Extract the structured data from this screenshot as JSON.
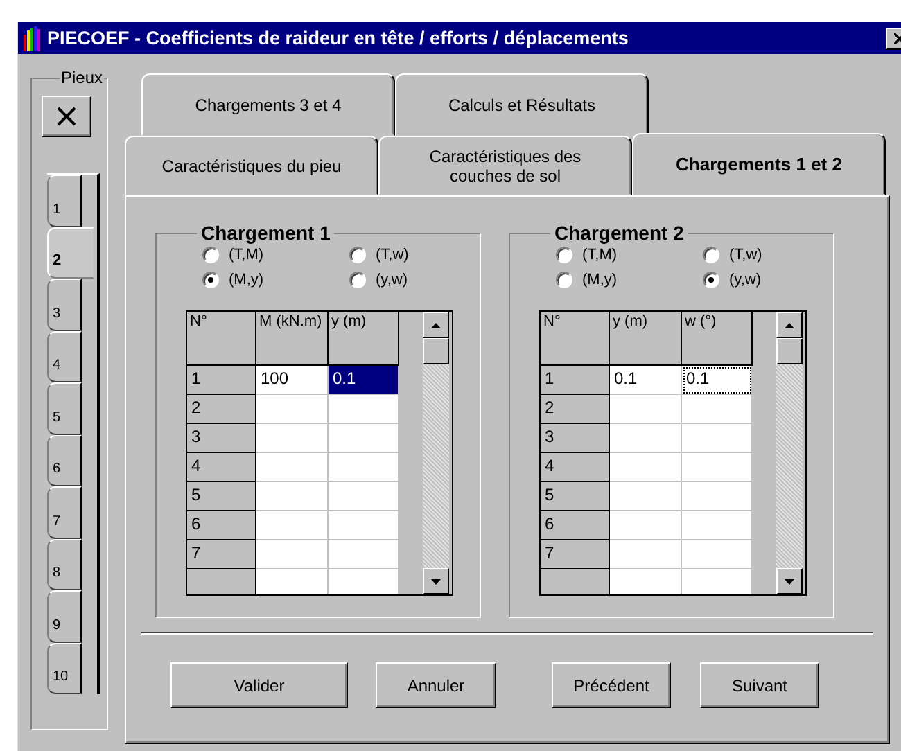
{
  "window": {
    "title": "PIECOEF - Coefficients de raideur en tête / efforts / déplacements"
  },
  "piles": {
    "label": "Pieux",
    "tabs": [
      {
        "label": "1",
        "selected": false
      },
      {
        "label": "2",
        "selected": true
      },
      {
        "label": "3",
        "selected": false
      },
      {
        "label": "4",
        "selected": false
      },
      {
        "label": "5",
        "selected": false
      },
      {
        "label": "6",
        "selected": false
      },
      {
        "label": "7",
        "selected": false
      },
      {
        "label": "8",
        "selected": false
      },
      {
        "label": "9",
        "selected": false
      },
      {
        "label": "10",
        "selected": false
      }
    ]
  },
  "tab_rows": [
    {
      "tabs": [
        {
          "label": "Chargements 3 et 4",
          "selected": false
        },
        {
          "label": "Calculs et Résultats",
          "selected": false
        }
      ]
    },
    {
      "tabs": [
        {
          "label": "Caractéristiques du pieu",
          "selected": false
        },
        {
          "label": "Caractéristiques des couches de sol",
          "selected": false
        },
        {
          "label": "Chargements 1 et 2",
          "selected": true
        }
      ]
    }
  ],
  "loads": [
    {
      "title": "Chargement 1",
      "options": [
        {
          "label": "(T,M)",
          "selected": false
        },
        {
          "label": "(T,w)",
          "selected": false
        },
        {
          "label": "(M,y)",
          "selected": true
        },
        {
          "label": "(y,w)",
          "selected": false
        }
      ],
      "table": {
        "columns": [
          "N°",
          "M (kN.m)",
          "y (m)"
        ],
        "rows": [
          {
            "label": "1",
            "cells": [
              {
                "text": "100",
                "selected": false,
                "focused": false
              },
              {
                "text": "0.1",
                "selected": true,
                "focused": false
              }
            ]
          },
          {
            "label": "2"
          },
          {
            "label": "3"
          },
          {
            "label": "4"
          },
          {
            "label": "5"
          },
          {
            "label": "6"
          },
          {
            "label": "7"
          }
        ]
      }
    },
    {
      "title": "Chargement 2",
      "options": [
        {
          "label": "(T,M)",
          "selected": false
        },
        {
          "label": "(T,w)",
          "selected": false
        },
        {
          "label": "(M,y)",
          "selected": false
        },
        {
          "label": "(y,w)",
          "selected": true
        }
      ],
      "table": {
        "columns": [
          "N°",
          "y (m)",
          "w (°)"
        ],
        "rows": [
          {
            "label": "1",
            "cells": [
              {
                "text": "0.1",
                "selected": false,
                "focused": false
              },
              {
                "text": "0.1",
                "selected": false,
                "focused": true
              }
            ]
          },
          {
            "label": "2"
          },
          {
            "label": "3"
          },
          {
            "label": "4"
          },
          {
            "label": "5"
          },
          {
            "label": "6"
          },
          {
            "label": "7"
          }
        ]
      }
    }
  ],
  "buttons": [
    "Valider",
    "Annuler",
    "Précédent",
    "Suivant"
  ]
}
